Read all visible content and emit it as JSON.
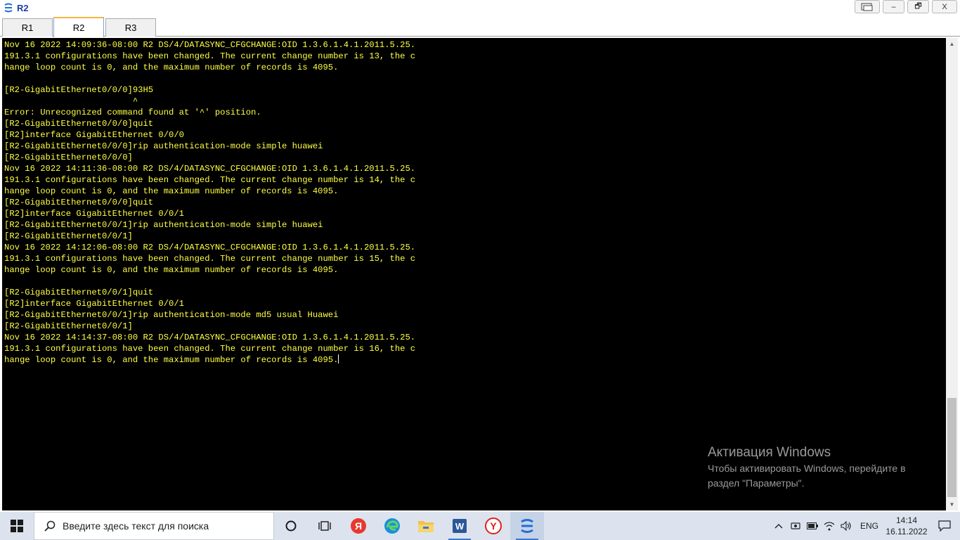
{
  "window": {
    "title": "R2",
    "buttons": {
      "extra": "restore-window",
      "minimize": "–",
      "restore": "🗗",
      "close": "X"
    }
  },
  "tabs": [
    {
      "label": "R1",
      "active": false
    },
    {
      "label": "R2",
      "active": true
    },
    {
      "label": "R3",
      "active": false
    }
  ],
  "terminal": {
    "text_color": "#ffff44",
    "background": "#000000",
    "lines": [
      "Nov 16 2022 14:09:36-08:00 R2 DS/4/DATASYNC_CFGCHANGE:OID 1.3.6.1.4.1.2011.5.25.",
      "191.3.1 configurations have been changed. The current change number is 13, the c",
      "hange loop count is 0, and the maximum number of records is 4095.",
      "",
      "[R2-GigabitEthernet0/0/0]93H5",
      "                         ^",
      "Error: Unrecognized command found at '^' position.",
      "[R2-GigabitEthernet0/0/0]quit",
      "[R2]interface GigabitEthernet 0/0/0",
      "[R2-GigabitEthernet0/0/0]rip authentication-mode simple huawei",
      "[R2-GigabitEthernet0/0/0]",
      "Nov 16 2022 14:11:36-08:00 R2 DS/4/DATASYNC_CFGCHANGE:OID 1.3.6.1.4.1.2011.5.25.",
      "191.3.1 configurations have been changed. The current change number is 14, the c",
      "hange loop count is 0, and the maximum number of records is 4095.",
      "[R2-GigabitEthernet0/0/0]quit",
      "[R2]interface GigabitEthernet 0/0/1",
      "[R2-GigabitEthernet0/0/1]rip authentication-mode simple huawei",
      "[R2-GigabitEthernet0/0/1]",
      "Nov 16 2022 14:12:06-08:00 R2 DS/4/DATASYNC_CFGCHANGE:OID 1.3.6.1.4.1.2011.5.25.",
      "191.3.1 configurations have been changed. The current change number is 15, the c",
      "hange loop count is 0, and the maximum number of records is 4095.",
      "",
      "[R2-GigabitEthernet0/0/1]quit",
      "[R2]interface GigabitEthernet 0/0/1",
      "[R2-GigabitEthernet0/0/1]rip authentication-mode md5 usual Huawei",
      "[R2-GigabitEthernet0/0/1]",
      "Nov 16 2022 14:14:37-08:00 R2 DS/4/DATASYNC_CFGCHANGE:OID 1.3.6.1.4.1.2011.5.25.",
      "191.3.1 configurations have been changed. The current change number is 16, the c",
      "hange loop count is 0, and the maximum number of records is 4095."
    ]
  },
  "activation": {
    "title": "Активация Windows",
    "text": "Чтобы активировать Windows, перейдите в раздел \"Параметры\"."
  },
  "taskbar": {
    "search_placeholder": "Введите здесь текст для поиска",
    "language": "ENG",
    "time": "14:14",
    "date": "16.11.2022",
    "icons": [
      "cortana-icon",
      "task-view-icon",
      "yandex-browser-icon",
      "edge-icon",
      "file-explorer-icon",
      "word-icon",
      "yandex-icon",
      "ensp-icon"
    ]
  }
}
